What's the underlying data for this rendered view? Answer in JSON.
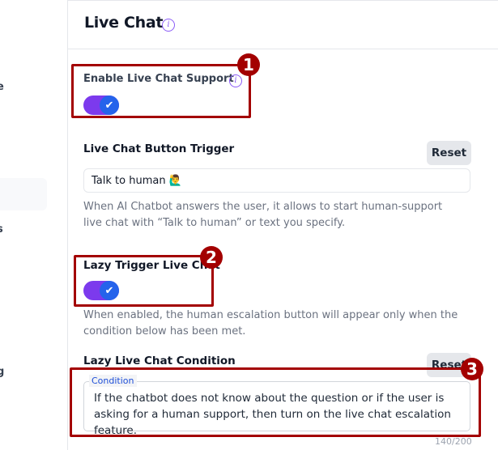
{
  "sidebar": {
    "fragments": [
      "e",
      "s",
      "g"
    ]
  },
  "header": {
    "title": "Live Chat",
    "info_icon": "info-icon"
  },
  "enable_live_chat": {
    "label": "Enable Live Chat Support",
    "enabled": true,
    "check_glyph": "✔",
    "info_glyph": "i"
  },
  "button_trigger": {
    "label": "Live Chat Button Trigger",
    "reset_label": "Reset",
    "value": "Talk to human 🙋‍♂️",
    "help": "When AI Chatbot answers the user, it allows to start human-support live chat with “Talk to human” or text you specify."
  },
  "lazy_trigger": {
    "label": "Lazy Trigger Live Chat",
    "enabled": true,
    "check_glyph": "✔",
    "help": "When enabled, the human escalation button will appear only when the condition below has been met."
  },
  "lazy_condition": {
    "label": "Lazy Live Chat Condition",
    "reset_label": "Reset",
    "field_legend": "Condition",
    "value": "If the chatbot does not know about the question or if the user is asking for a human support, then turn on the live chat escalation feature.",
    "char_count": "140/200"
  },
  "annotations": [
    "1",
    "2",
    "3"
  ],
  "colors": {
    "toggle_track": "#7c3aed",
    "toggle_knob": "#2563eb",
    "accent_info": "#8b5cf6",
    "annotation": "#a30000"
  }
}
